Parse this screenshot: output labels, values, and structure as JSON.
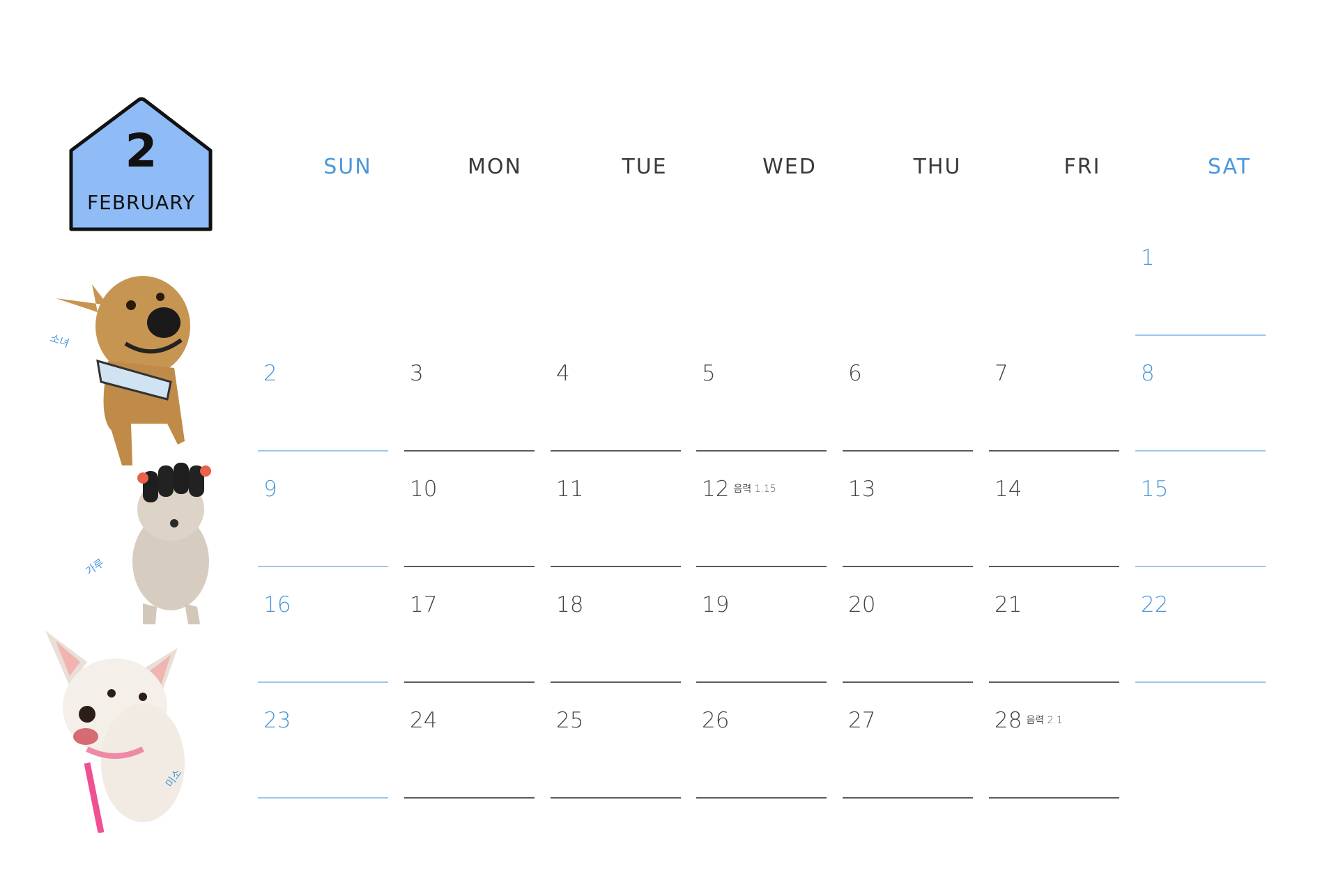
{
  "month": {
    "number": "2",
    "name": "FEBRUARY"
  },
  "colors": {
    "accent": "#4a97db",
    "badge_fill": "#8fbcf6",
    "text": "#3c3c3c"
  },
  "weekdays": [
    "SUN",
    "MON",
    "TUE",
    "WED",
    "THU",
    "FRI",
    "SAT"
  ],
  "weeks": [
    [
      null,
      null,
      null,
      null,
      null,
      null,
      {
        "day": "1"
      }
    ],
    [
      {
        "day": "2"
      },
      {
        "day": "3"
      },
      {
        "day": "4"
      },
      {
        "day": "5"
      },
      {
        "day": "6"
      },
      {
        "day": "7"
      },
      {
        "day": "8"
      }
    ],
    [
      {
        "day": "9"
      },
      {
        "day": "10"
      },
      {
        "day": "11"
      },
      {
        "day": "12",
        "note": "음력 1.15"
      },
      {
        "day": "13"
      },
      {
        "day": "14"
      },
      {
        "day": "15"
      }
    ],
    [
      {
        "day": "16"
      },
      {
        "day": "17"
      },
      {
        "day": "18"
      },
      {
        "day": "19"
      },
      {
        "day": "20"
      },
      {
        "day": "21"
      },
      {
        "day": "22"
      }
    ],
    [
      {
        "day": "23"
      },
      {
        "day": "24"
      },
      {
        "day": "25"
      },
      {
        "day": "26"
      },
      {
        "day": "27"
      },
      {
        "day": "28",
        "note": "음력 2.1"
      },
      null
    ]
  ],
  "dogs": [
    {
      "name": "소녀",
      "icon": "tan-dog-photo"
    },
    {
      "name": "가루",
      "icon": "dog-with-hair-rollers-photo"
    },
    {
      "name": "미소",
      "icon": "white-dog-photo"
    }
  ]
}
